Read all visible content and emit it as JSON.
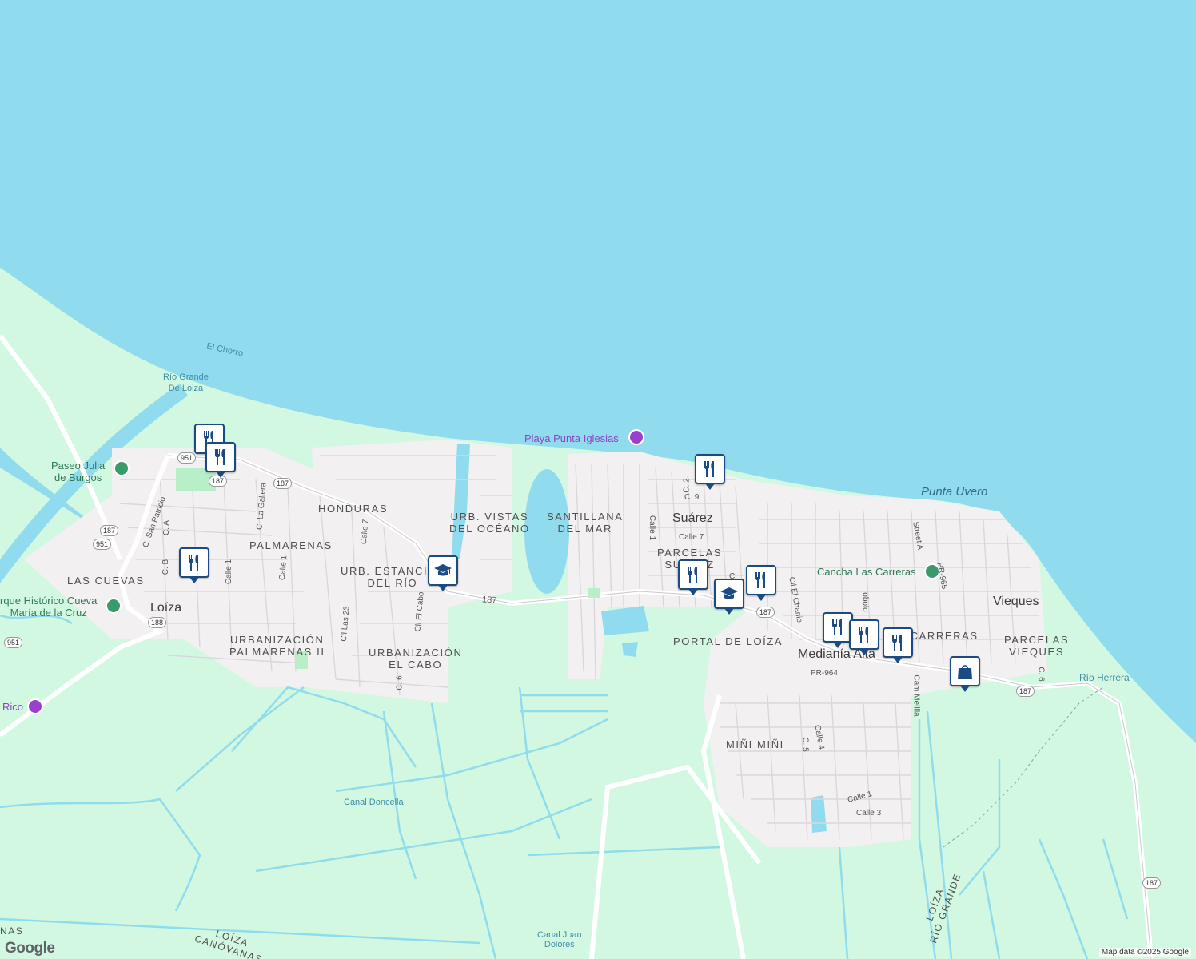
{
  "map": {
    "water_color": "#90dbed",
    "land_color": "#d3f8e2",
    "urban_color": "#f2f0f1",
    "marker_color": "#1b4b82",
    "places": {
      "loiza": "Loíza",
      "suarez": "Suárez",
      "vieques": "Vieques",
      "mediania_alta": "Medianía Alta"
    },
    "neighborhoods": {
      "honduras": "HONDURAS",
      "palmarenas": "PALMARENAS",
      "las_cuevas": "LAS CUEVAS",
      "urb_vistas_oceano": "URB. VISTAS\nDEL OCÉANO",
      "santillana": "SANTILLANA\nDEL MAR",
      "urb_estancias": "URB. ESTANCIAS\nDEL RÍO",
      "urb_palmarenas_ii": "URBANIZACIÓN\nPALMARENAS II",
      "urb_el_cabo": "URBANIZACIÓN\nEL CABO",
      "parcelas_suarez": "PARCELAS\nSUÁREZ",
      "portal_loiza": "PORTAL DE LOÍZA",
      "las_carreras": "LAS CARRERAS",
      "parcelas_vieques": "PARCELAS\nVIEQUES",
      "mini_mini": "MIÑI MIÑI"
    },
    "water_labels": {
      "el_chorro": "El Chorro",
      "rio_grande_loiza": "Río Grande\nDe Loiza",
      "punta_uvero": "Punta Uvero",
      "canal_doncella": "Canal Doncella",
      "canal_juan_dolores": "Canal Juan\nDolores",
      "rio_herrera": "Río Herrera"
    },
    "pois": {
      "playa": "Playa Punta Iglesias",
      "paseo": "Paseo Julia\nde Burgos",
      "parque": "rque Histórico Cueva\nMaría de la Cruz",
      "cancha": "Cancha Las Carreras",
      "rico": "Rico"
    },
    "streets": {
      "s187": "187",
      "c_san_patricio": "C. San Patricio",
      "c_a": "C. A",
      "c_b": "C. B",
      "calle_1_a": "Calle 1",
      "c_la_gallera": "C. La Gallera",
      "calle_1_b": "Calle 1",
      "calle_7": "Calle 7",
      "cll_las_23": "Cll Las 23",
      "cll_el_cabo": "Cll El Cabo",
      "c_6": "C. 6",
      "c_2": "C. 2",
      "c_9": "C. 9",
      "calle_1_c": "Calle 1",
      "calle_7_b": "Calle 7",
      "cll_el_charlie": "Cll El Charlie",
      "street_a": "Street A",
      "pr_965": "PR-965",
      "pr_964": "PR-964",
      "cam_melilla": "Cam Melilla",
      "calle_4": "Calle 4",
      "c_5": "C. 5",
      "calle_1_d": "Calle 1",
      "calle_3": "Calle 3",
      "c_6_b": "C. 6",
      "c_l": "C",
      "loiza_rio_grande": "LOÍZA\nRÍO GRANDE",
      "loiza_canovanas": "LOÍZA\nCANÓVANAS",
      "obolo": "obolo"
    },
    "shields": [
      "951",
      "187",
      "187",
      "187",
      "951",
      "188",
      "951",
      "187",
      "187",
      "187"
    ],
    "markers": {
      "restaurant": "restaurant-marker",
      "school": "school-marker",
      "shopping": "shopping-marker"
    },
    "attribution": "Map data ©2025 Google",
    "logo": "Google"
  }
}
